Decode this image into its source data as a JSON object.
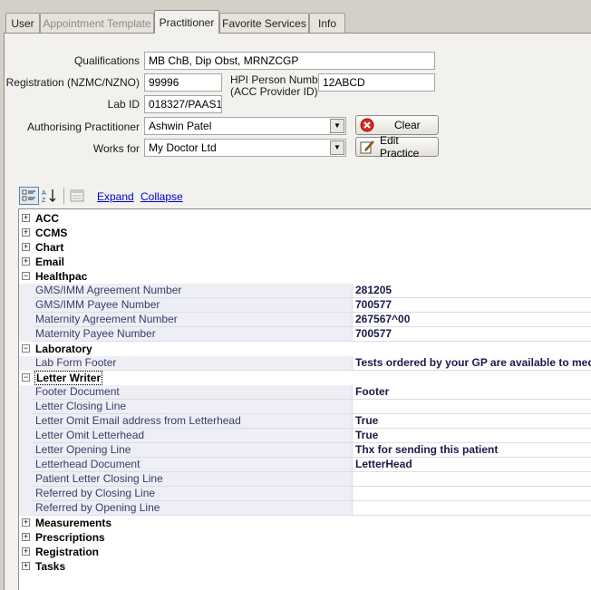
{
  "tabs": [
    {
      "label": "User",
      "state": "normal"
    },
    {
      "label": "Appointment Template",
      "state": "disabled"
    },
    {
      "label": "Practitioner",
      "state": "active"
    },
    {
      "label": "Favorite Services",
      "state": "normal"
    },
    {
      "label": "Info",
      "state": "normal"
    }
  ],
  "form": {
    "qualifications_label": "Qualifications",
    "qualifications_value": "MB ChB, Dip Obst, MRNZCGP",
    "registration_label": "Registration (NZMC/NZNO)",
    "registration_value": "99996",
    "hpi_label_line1": "HPI Person Number",
    "hpi_label_line2": "(ACC Provider ID)",
    "hpi_value": "12ABCD",
    "labid_label": "Lab ID",
    "labid_value": "018327/PAAS1",
    "authorising_label": "Authorising Practitioner",
    "authorising_value": "Ashwin Patel",
    "worksfor_label": "Works for",
    "worksfor_value": "My Doctor Ltd",
    "clear_label": "Clear",
    "edit_practice_label": "Edit Practice"
  },
  "toolbar": {
    "expand_label": "Expand",
    "collapse_label": "Collapse"
  },
  "grid": {
    "rows": [
      {
        "type": "cat",
        "name": "ACC",
        "expanded": false
      },
      {
        "type": "cat",
        "name": "CCMS",
        "expanded": false
      },
      {
        "type": "cat",
        "name": "Chart",
        "expanded": false
      },
      {
        "type": "cat",
        "name": "Email",
        "expanded": false
      },
      {
        "type": "cat",
        "name": "Healthpac",
        "expanded": true
      },
      {
        "type": "prop",
        "name": "GMS/IMM Agreement Number",
        "value": "281205"
      },
      {
        "type": "prop",
        "name": "GMS/IMM Payee Number",
        "value": "700577"
      },
      {
        "type": "prop",
        "name": "Maternity Agreement Number",
        "value": "267567^00"
      },
      {
        "type": "prop",
        "name": "Maternity Payee Number",
        "value": "700577"
      },
      {
        "type": "cat",
        "name": "Laboratory",
        "expanded": true
      },
      {
        "type": "prop",
        "name": "Lab Form Footer",
        "value": "Tests ordered by your GP are available to med"
      },
      {
        "type": "cat",
        "name": "Letter Writer",
        "expanded": true,
        "selected": true
      },
      {
        "type": "prop",
        "name": "Footer Document",
        "value": "Footer"
      },
      {
        "type": "prop",
        "name": "Letter Closing Line",
        "value": ""
      },
      {
        "type": "prop",
        "name": "Letter Omit Email address from Letterhead",
        "value": "True"
      },
      {
        "type": "prop",
        "name": "Letter Omit Letterhead",
        "value": "True"
      },
      {
        "type": "prop",
        "name": "Letter Opening Line",
        "value": "Thx for sending this patient"
      },
      {
        "type": "prop",
        "name": "Letterhead Document",
        "value": "LetterHead"
      },
      {
        "type": "prop",
        "name": "Patient Letter Closing Line",
        "value": ""
      },
      {
        "type": "prop",
        "name": "Referred by Closing Line",
        "value": ""
      },
      {
        "type": "prop",
        "name": "Referred by Opening Line",
        "value": ""
      },
      {
        "type": "cat",
        "name": "Measurements",
        "expanded": false
      },
      {
        "type": "cat",
        "name": "Prescriptions",
        "expanded": false
      },
      {
        "type": "cat",
        "name": "Registration",
        "expanded": false
      },
      {
        "type": "cat",
        "name": "Tasks",
        "expanded": false
      }
    ]
  }
}
